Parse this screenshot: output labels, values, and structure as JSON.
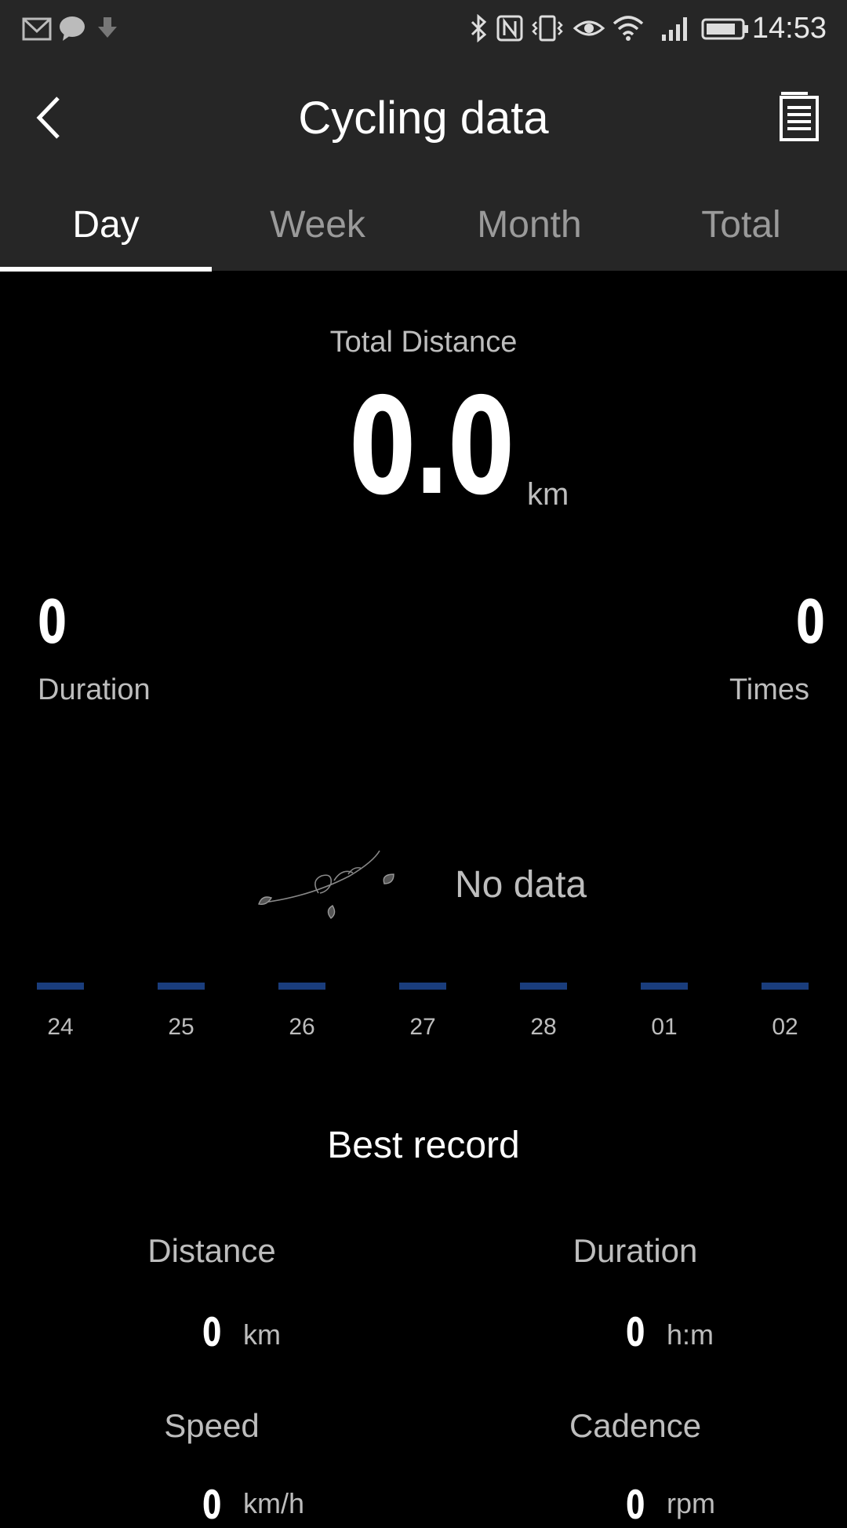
{
  "status_bar": {
    "time": "14:53",
    "left_icons": [
      "gmail-icon",
      "chat-bubble-icon",
      "download-icon"
    ],
    "right_icons": [
      "bluetooth-icon",
      "nfc-icon",
      "vibrate-icon",
      "eye-icon",
      "wifi-icon",
      "signal-icon",
      "battery-icon"
    ]
  },
  "header": {
    "title": "Cycling data"
  },
  "tabs": [
    {
      "label": "Day",
      "active": true
    },
    {
      "label": "Week",
      "active": false
    },
    {
      "label": "Month",
      "active": false
    },
    {
      "label": "Total",
      "active": false
    }
  ],
  "summary": {
    "total_distance_label": "Total Distance",
    "total_distance_value": "0.0",
    "total_distance_unit": "km",
    "duration_value": "0",
    "duration_label": "Duration",
    "times_value": "0",
    "times_label": "Times"
  },
  "chart": {
    "no_data_text": "No data",
    "bar_color": "#1a3d7c",
    "days": [
      "24",
      "25",
      "26",
      "27",
      "28",
      "01",
      "02"
    ]
  },
  "best_record": {
    "title": "Best record",
    "distance_label": "Distance",
    "distance_value": "0",
    "distance_unit": "km",
    "duration_label": "Duration",
    "duration_value": "0",
    "duration_unit": "h:m",
    "speed_label": "Speed",
    "speed_value": "0",
    "speed_unit": "km/h",
    "cadence_label": "Cadence",
    "cadence_value": "0",
    "cadence_unit": "rpm"
  }
}
